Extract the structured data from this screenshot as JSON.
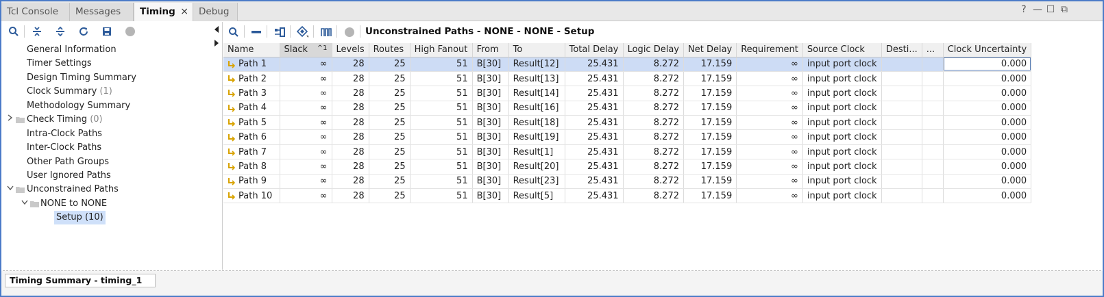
{
  "tabs": [
    {
      "label": "Tcl Console"
    },
    {
      "label": "Messages"
    },
    {
      "label": "Timing",
      "active": true,
      "close": "×"
    },
    {
      "label": "Debug"
    }
  ],
  "window_controls": {
    "help": "?",
    "minimize": "—",
    "restore": "☐",
    "float": "⧉"
  },
  "left_toolbar_icons": [
    "search-icon",
    "collapse-all-icon",
    "expand-all-icon",
    "refresh-icon",
    "save-icon",
    "stop-icon"
  ],
  "tree": [
    {
      "label": "General Information"
    },
    {
      "label": "Timer Settings"
    },
    {
      "label": "Design Timing Summary"
    },
    {
      "label": "Clock Summary",
      "count": "(1)"
    },
    {
      "label": "Methodology Summary"
    },
    {
      "label": "Check Timing",
      "count": "(0)"
    },
    {
      "label": "Intra-Clock Paths"
    },
    {
      "label": "Inter-Clock Paths"
    },
    {
      "label": "Other Path Groups"
    },
    {
      "label": "User Ignored Paths"
    },
    {
      "label": "Unconstrained Paths"
    },
    {
      "label": "NONE to NONE"
    },
    {
      "label": "Setup (10)"
    }
  ],
  "right_toolbar_icons": [
    "search-icon",
    "minus-icon",
    "schematic-icon",
    "highlight-icon",
    "waveform-icon",
    "stop-icon"
  ],
  "results_title": "Unconstrained Paths - NONE - NONE - Setup",
  "table": {
    "columns": [
      "Name",
      "Slack",
      "Levels",
      "Routes",
      "High Fanout",
      "From",
      "To",
      "Total Delay",
      "Logic Delay",
      "Net Delay",
      "Requirement",
      "Source Clock",
      "Desti...",
      "...",
      "Clock Uncertainty"
    ],
    "sort_indicator": "^1",
    "rows": [
      [
        "Path 1",
        "∞",
        "28",
        "25",
        "51",
        "B[30]",
        "Result[12]",
        "25.431",
        "8.272",
        "17.159",
        "∞",
        "input port clock",
        "",
        "",
        "0.000"
      ],
      [
        "Path 2",
        "∞",
        "28",
        "25",
        "51",
        "B[30]",
        "Result[13]",
        "25.431",
        "8.272",
        "17.159",
        "∞",
        "input port clock",
        "",
        "",
        "0.000"
      ],
      [
        "Path 3",
        "∞",
        "28",
        "25",
        "51",
        "B[30]",
        "Result[14]",
        "25.431",
        "8.272",
        "17.159",
        "∞",
        "input port clock",
        "",
        "",
        "0.000"
      ],
      [
        "Path 4",
        "∞",
        "28",
        "25",
        "51",
        "B[30]",
        "Result[16]",
        "25.431",
        "8.272",
        "17.159",
        "∞",
        "input port clock",
        "",
        "",
        "0.000"
      ],
      [
        "Path 5",
        "∞",
        "28",
        "25",
        "51",
        "B[30]",
        "Result[18]",
        "25.431",
        "8.272",
        "17.159",
        "∞",
        "input port clock",
        "",
        "",
        "0.000"
      ],
      [
        "Path 6",
        "∞",
        "28",
        "25",
        "51",
        "B[30]",
        "Result[19]",
        "25.431",
        "8.272",
        "17.159",
        "∞",
        "input port clock",
        "",
        "",
        "0.000"
      ],
      [
        "Path 7",
        "∞",
        "28",
        "25",
        "51",
        "B[30]",
        "Result[1]",
        "25.431",
        "8.272",
        "17.159",
        "∞",
        "input port clock",
        "",
        "",
        "0.000"
      ],
      [
        "Path 8",
        "∞",
        "28",
        "25",
        "51",
        "B[30]",
        "Result[20]",
        "25.431",
        "8.272",
        "17.159",
        "∞",
        "input port clock",
        "",
        "",
        "0.000"
      ],
      [
        "Path 9",
        "∞",
        "28",
        "25",
        "51",
        "B[30]",
        "Result[23]",
        "25.431",
        "8.272",
        "17.159",
        "∞",
        "input port clock",
        "",
        "",
        "0.000"
      ],
      [
        "Path 10",
        "∞",
        "28",
        "25",
        "51",
        "B[30]",
        "Result[5]",
        "25.431",
        "8.272",
        "17.159",
        "∞",
        "input port clock",
        "",
        "",
        "0.000"
      ]
    ]
  },
  "bottom_tab": "Timing Summary - timing_1",
  "colors": {
    "accent_border": "#4b7bc8",
    "selection": "#cddcf5",
    "path_icon": "#d9a300"
  }
}
